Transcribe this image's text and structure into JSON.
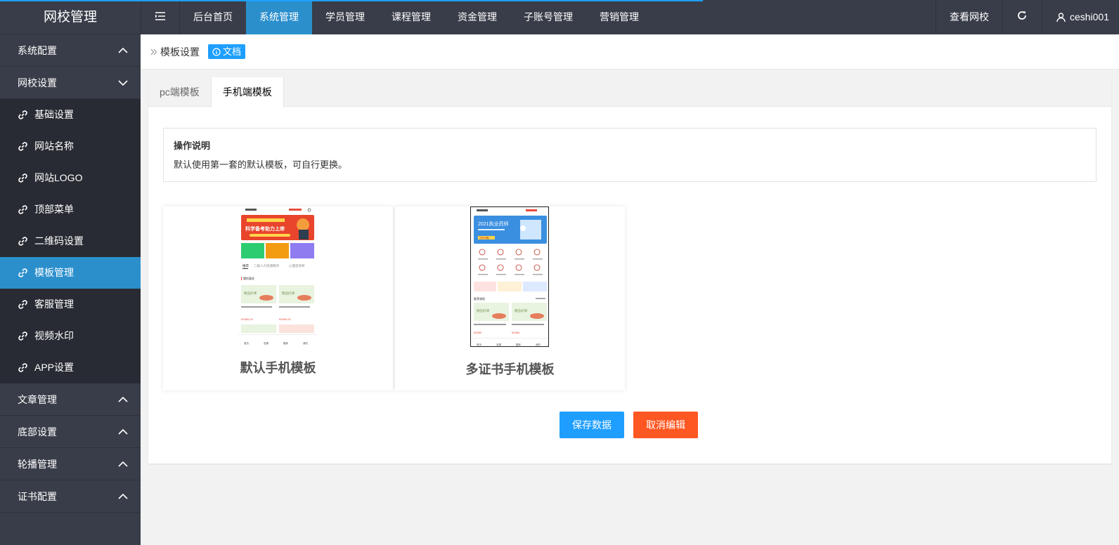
{
  "app": {
    "title": "网校管理"
  },
  "header": {
    "nav": [
      "后台首页",
      "系统管理",
      "学员管理",
      "课程管理",
      "资金管理",
      "子账号管理",
      "营销管理"
    ],
    "view_site": "查看网校",
    "username": "ceshi001"
  },
  "sidebar": {
    "groups_top": [
      {
        "label": "系统配置"
      }
    ],
    "open_group": {
      "label": "网校设置",
      "items": [
        "基础设置",
        "网站名称",
        "网站LOGO",
        "顶部菜单",
        "二维码设置",
        "模板管理",
        "客服管理",
        "视频水印",
        "APP设置"
      ]
    },
    "groups_bottom": [
      "文章管理",
      "底部设置",
      "轮播管理",
      "证书配置"
    ]
  },
  "breadcrumb": {
    "current": "模板设置",
    "doc_label": "文档"
  },
  "tabs": [
    "pc端模板",
    "手机端模板"
  ],
  "note": {
    "title": "操作说明",
    "text": "默认使用第一套的默认模板，可自行更换。"
  },
  "templates": [
    {
      "label": "默认手机模板",
      "preview": {
        "banner_text": "科学备考助力上岸",
        "tabs": [
          "推荐",
          "二级人力资源网评",
          "心理咨询师"
        ],
        "section": "猜你喜欢",
        "course_tag": "精品好课",
        "price": "¥2980.00",
        "footer": [
          "首页",
          "选课",
          "题库",
          "我的"
        ]
      }
    },
    {
      "label": "多证书手机模板",
      "preview": {
        "banner_text": "2021执业药师",
        "banner_sub": "快来领取",
        "section": "推荐课程",
        "course_tag": "精品好课",
        "price": "¥2980",
        "footer": [
          "首页",
          "选课",
          "题库",
          "我的"
        ]
      }
    }
  ],
  "buttons": {
    "save": "保存数据",
    "cancel": "取消编辑"
  },
  "colors": {
    "sidebar_bg": "#393d49",
    "accent": "#2b8fcc",
    "primary": "#1e9fff",
    "danger": "#ff5722"
  }
}
